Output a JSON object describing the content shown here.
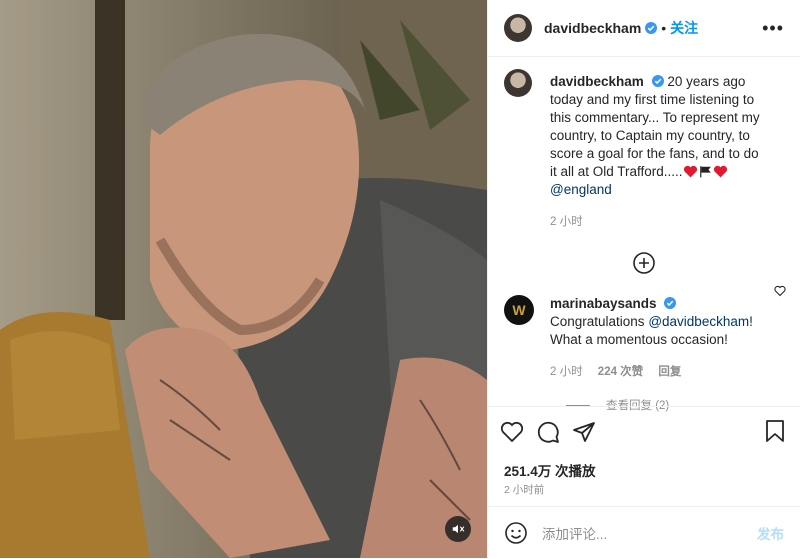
{
  "header": {
    "username": "davidbeckham",
    "follow": "关注"
  },
  "caption": {
    "username": "davidbeckham",
    "text": "20 years ago today and my first time listening to this commentary... To represent my country, to Captain my country, to score a goal for the fans, and to do it all at Old Trafford.....",
    "emojis": [
      "red-heart",
      "black-flag",
      "red-heart"
    ],
    "mention": "@england",
    "time": "2 小时"
  },
  "reply_comment": {
    "username": "marinabaysands",
    "avatar_letter": "W",
    "text_before": "Congratulations",
    "mention": "@davidbeckham",
    "text_after": "! What a momentous occasion!",
    "time": "2 小时",
    "likes": "224 次赞",
    "reply": "回复",
    "view_replies": "查看回复 (2)"
  },
  "stats": {
    "views": "251.4万 次播放",
    "time": "2 小时前"
  },
  "add_comment": {
    "placeholder": "添加评论...",
    "post": "发布"
  },
  "icons": [
    "more-icon",
    "verified-icon",
    "load-more-icon",
    "heart-icon",
    "comment-icon",
    "share-icon",
    "bookmark-icon",
    "emoji-icon",
    "mute-icon"
  ],
  "colors": {
    "accent": "#0095f6",
    "heart": "#ed4956",
    "meta": "#8e8e8e"
  }
}
